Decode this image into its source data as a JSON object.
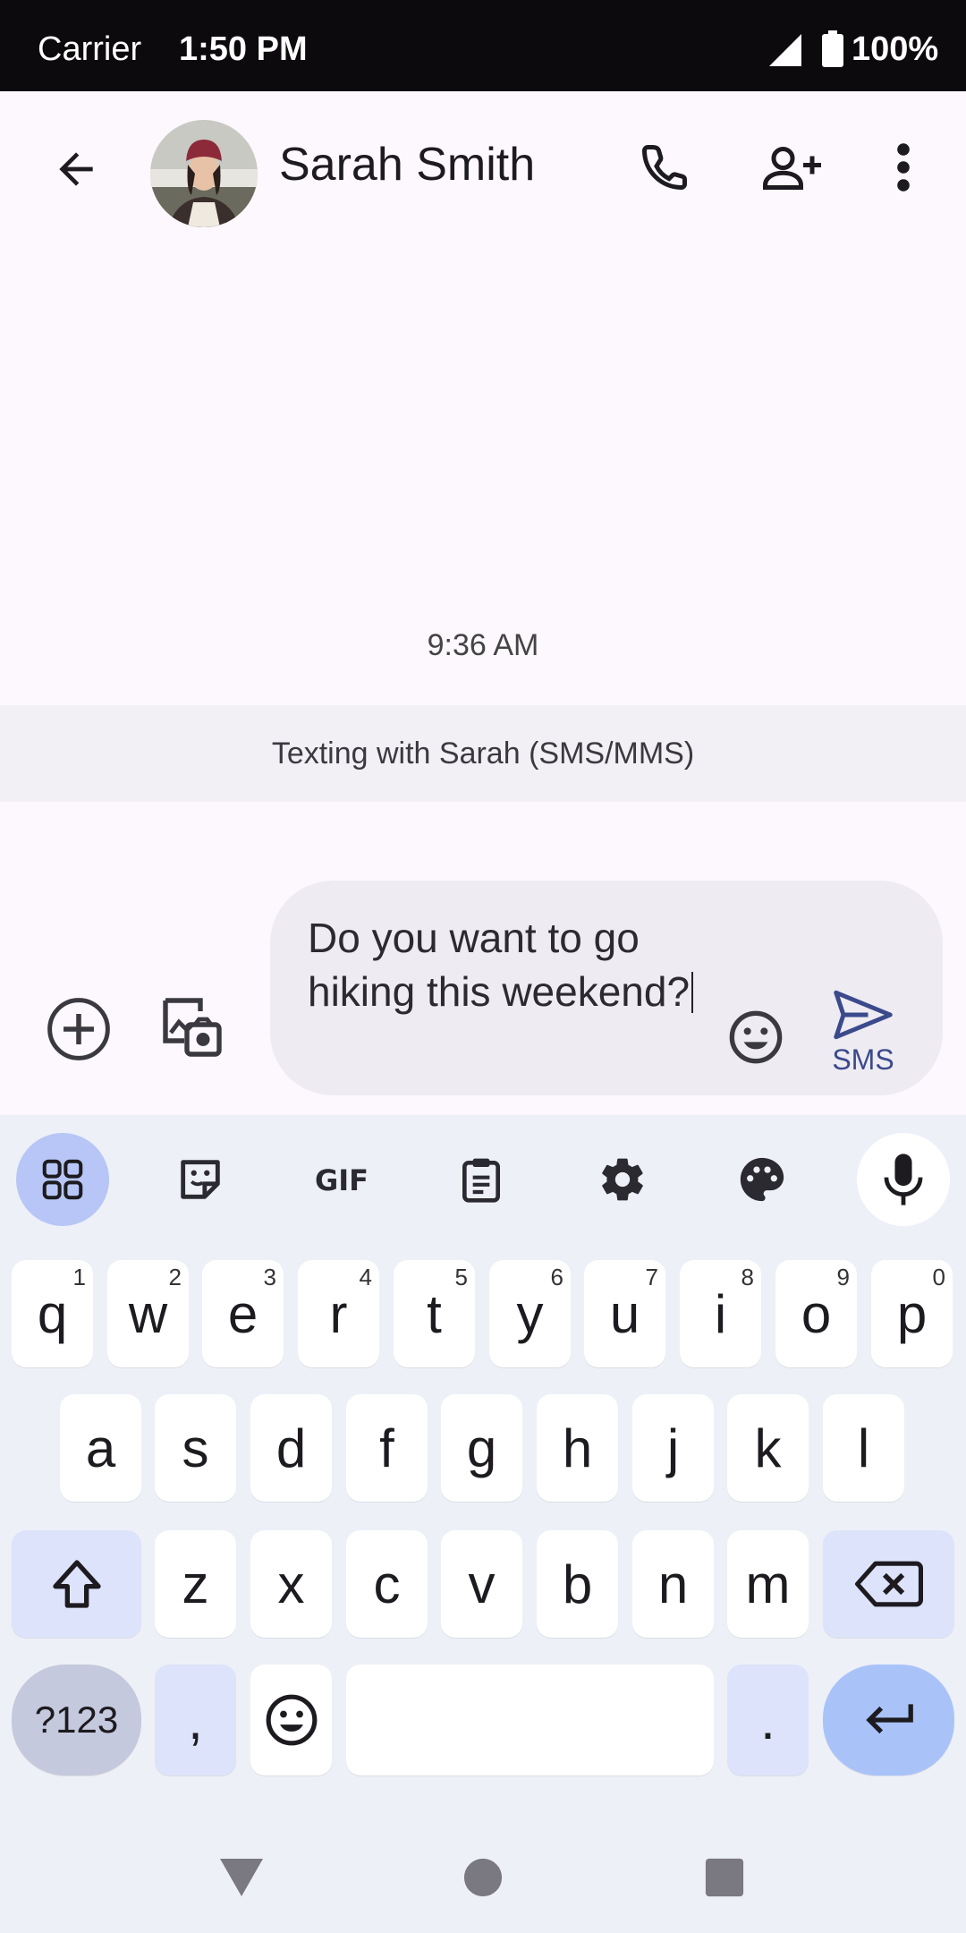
{
  "status_bar": {
    "carrier": "Carrier",
    "time": "1:50 PM",
    "battery": "100%"
  },
  "app_bar": {
    "contact_name": "Sarah Smith",
    "icons": [
      "back-arrow-icon",
      "phone-icon",
      "add-person-icon",
      "more-vert-icon"
    ]
  },
  "conversation": {
    "timestamp": "9:36 AM",
    "banner": "Texting with Sarah (SMS/MMS)"
  },
  "compose": {
    "text": "Do you want to go hiking this weekend?",
    "send_label": "SMS"
  },
  "keyboard": {
    "row1": [
      {
        "key": "q",
        "hint": "1"
      },
      {
        "key": "w",
        "hint": "2"
      },
      {
        "key": "e",
        "hint": "3"
      },
      {
        "key": "r",
        "hint": "4"
      },
      {
        "key": "t",
        "hint": "5"
      },
      {
        "key": "y",
        "hint": "6"
      },
      {
        "key": "u",
        "hint": "7"
      },
      {
        "key": "i",
        "hint": "8"
      },
      {
        "key": "o",
        "hint": "9"
      },
      {
        "key": "p",
        "hint": "0"
      }
    ],
    "row2": [
      "a",
      "s",
      "d",
      "f",
      "g",
      "h",
      "j",
      "k",
      "l"
    ],
    "row3": [
      "z",
      "x",
      "c",
      "v",
      "b",
      "n",
      "m"
    ],
    "symbols_label": "?123",
    "comma": ",",
    "period": "."
  },
  "colors": {
    "accent": "#3b4a8c",
    "keyboard_bg": "#eef0f7",
    "active_tool": "#b7c6f6"
  }
}
